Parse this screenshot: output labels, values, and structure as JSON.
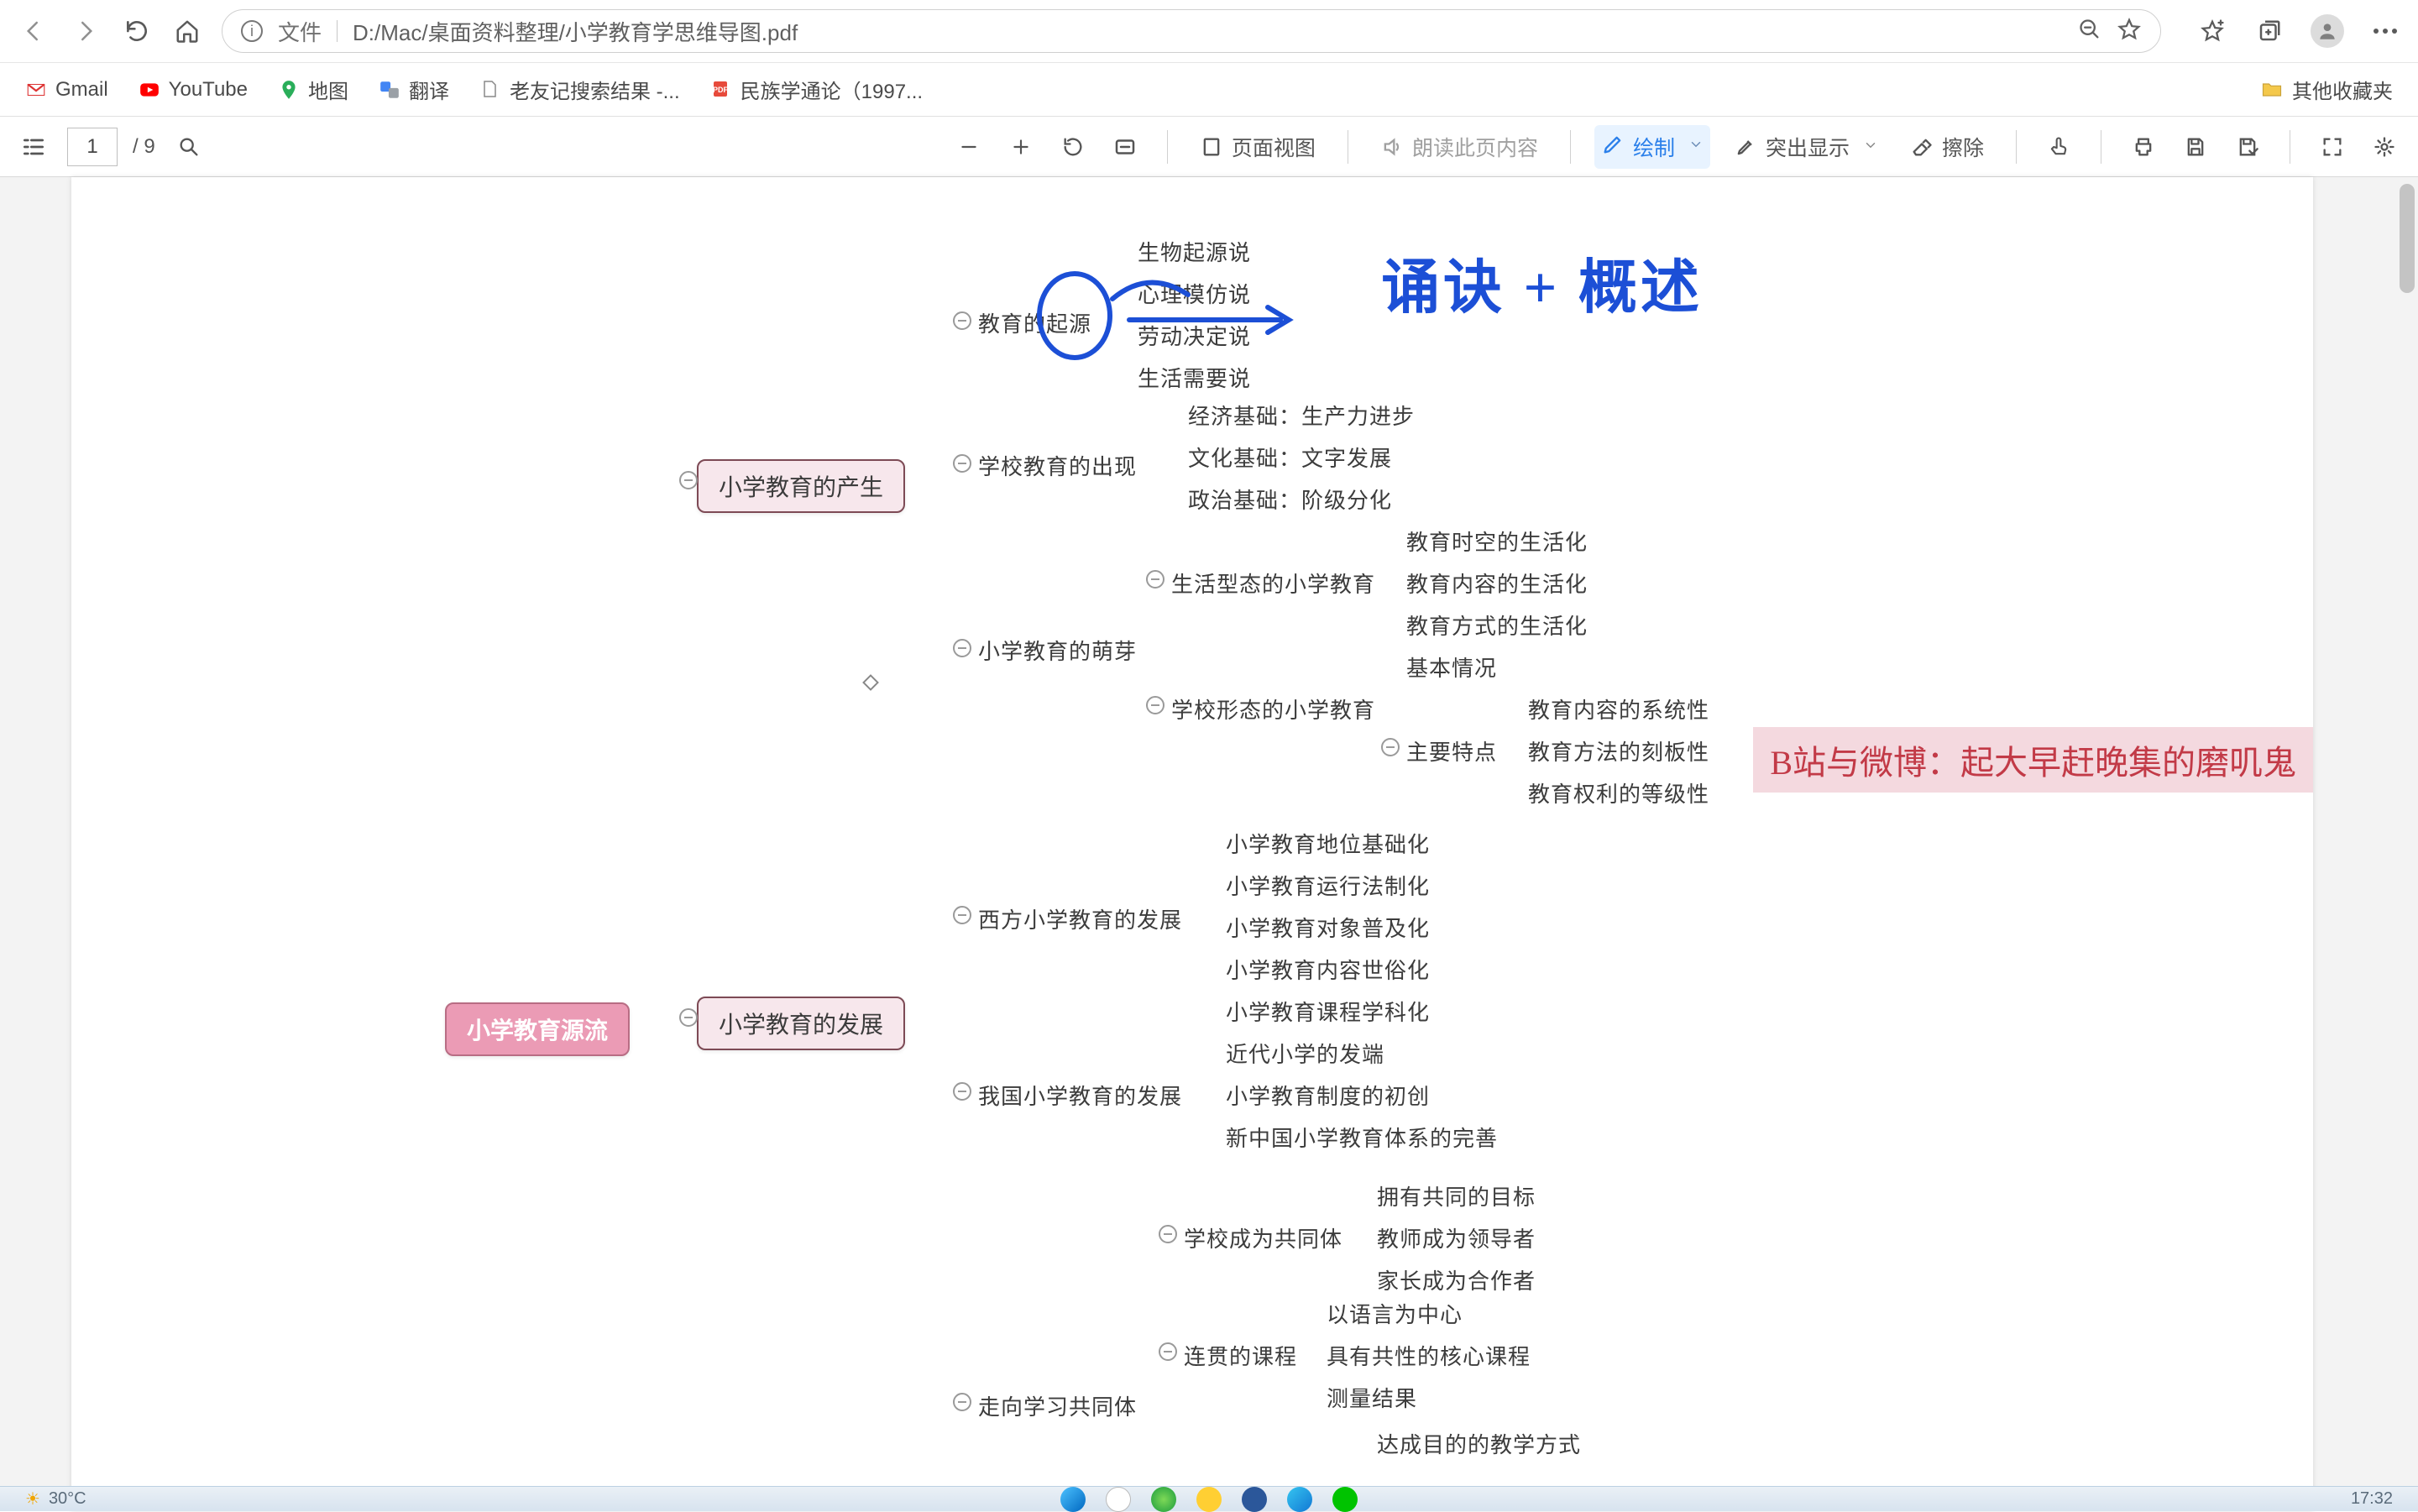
{
  "browser": {
    "address_label": "文件",
    "address_path": "D:/Mac/桌面资料整理/小学教育学思维导图.pdf",
    "bookmarks": [
      {
        "label": "Gmail",
        "icon": "gmail"
      },
      {
        "label": "YouTube",
        "icon": "youtube"
      },
      {
        "label": "地图",
        "icon": "maps"
      },
      {
        "label": "翻译",
        "icon": "translate"
      },
      {
        "label": "老友记搜索结果 -...",
        "icon": "page"
      },
      {
        "label": "民族学通论（1997...",
        "icon": "pdf"
      }
    ],
    "other_bookmarks_label": "其他收藏夹"
  },
  "pdfbar": {
    "page_current": "1",
    "page_total": "/ 9",
    "page_view": "页面视图",
    "read_aloud": "朗读此页内容",
    "draw": "绘制",
    "highlight": "突出显示",
    "erase": "擦除"
  },
  "mindmap": {
    "root": "小学教育源流",
    "b1": "小学教育的产生",
    "b2": "小学教育的发展",
    "n_origin": "教育的起源",
    "n_origin_1": "生物起源说",
    "n_origin_2": "心理模仿说",
    "n_origin_3": "劳动决定说",
    "n_origin_4": "生活需要说",
    "n_school": "学校教育的出现",
    "n_school_1": "经济基础：生产力进步",
    "n_school_2": "文化基础：文字发展",
    "n_school_3": "政治基础：阶级分化",
    "n_sprout": "小学教育的萌芽",
    "n_sprout_a": "生活型态的小学教育",
    "n_sprout_a1": "教育时空的生活化",
    "n_sprout_a2": "教育内容的生活化",
    "n_sprout_a3": "教育方式的生活化",
    "n_sprout_b": "学校形态的小学教育",
    "n_sprout_b1": "基本情况",
    "n_sprout_b2": "主要特点",
    "n_sprout_b2a": "教育内容的系统性",
    "n_sprout_b2b": "教育方法的刻板性",
    "n_sprout_b2c": "教育权利的等级性",
    "n_west": "西方小学教育的发展",
    "n_west_1": "小学教育地位基础化",
    "n_west_2": "小学教育运行法制化",
    "n_west_3": "小学教育对象普及化",
    "n_west_4": "小学教育内容世俗化",
    "n_west_5": "小学教育课程学科化",
    "n_cn": "我国小学教育的发展",
    "n_cn_1": "近代小学的发端",
    "n_cn_2": "小学教育制度的初创",
    "n_cn_3": "新中国小学教育体系的完善",
    "n_comm": "走向学习共同体",
    "n_comm_a": "学校成为共同体",
    "n_comm_a1": "拥有共同的目标",
    "n_comm_a2": "教师成为领导者",
    "n_comm_a3": "家长成为合作者",
    "n_comm_b": "连贯的课程",
    "n_comm_b1": "以语言为中心",
    "n_comm_b2": "具有共性的核心课程",
    "n_comm_b3": "测量结果",
    "n_comm_c1": "达成目的的教学方式"
  },
  "annotations": {
    "handwriting": "诵诀 + 概述",
    "banner": "B站与微博：起大早赶晚集的磨叽鬼"
  },
  "taskbar": {
    "weather_temp": "30°C",
    "clock": "17:32"
  }
}
